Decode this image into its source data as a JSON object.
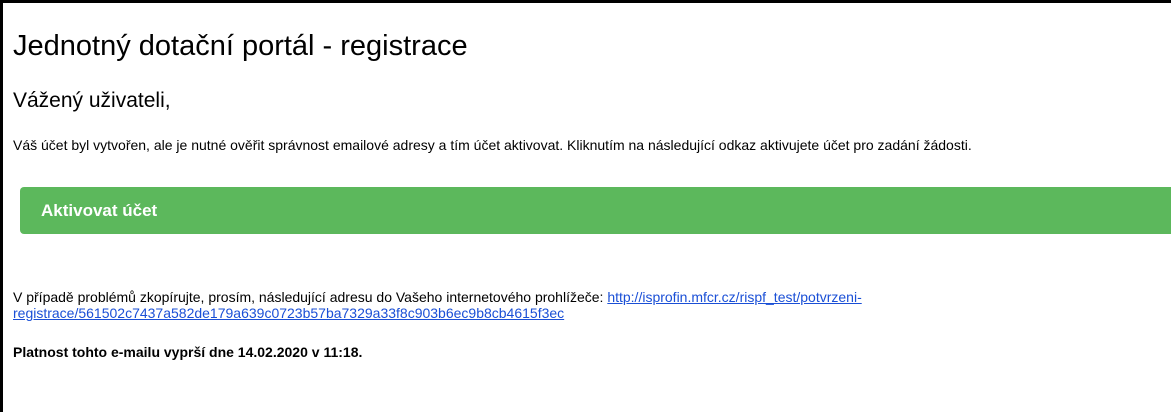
{
  "email": {
    "title": "Jednotný dotační portál - registrace",
    "greeting": "Vážený uživateli,",
    "intro": "Váš účet byl vytvořen, ale je nutné ověřit správnost emailové adresy a tím účet aktivovat. Kliknutím na následující odkaz aktivujete účet pro zadání žádosti.",
    "activate_button": "Aktivovat účet",
    "problem_text": "V případě problémů zkopírujte, prosím, následující adresu do Vašeho internetového prohlížeče: ",
    "problem_link_line1": "http://isprofin.mfcr.cz/rispf_test/potvrzeni-",
    "problem_link_line2": "registrace/561502c7437a582de179a639c0723b57ba7329a33f8c903b6ec9b8cb4615f3ec",
    "expiry": "Platnost tohto e-mailu vyprší dne 14.02.2020 v 11:18."
  },
  "colors": {
    "button_background": "#5cb85c",
    "button_text": "#ffffff",
    "link": "#1a4fd6",
    "frame_border": "#000000"
  }
}
